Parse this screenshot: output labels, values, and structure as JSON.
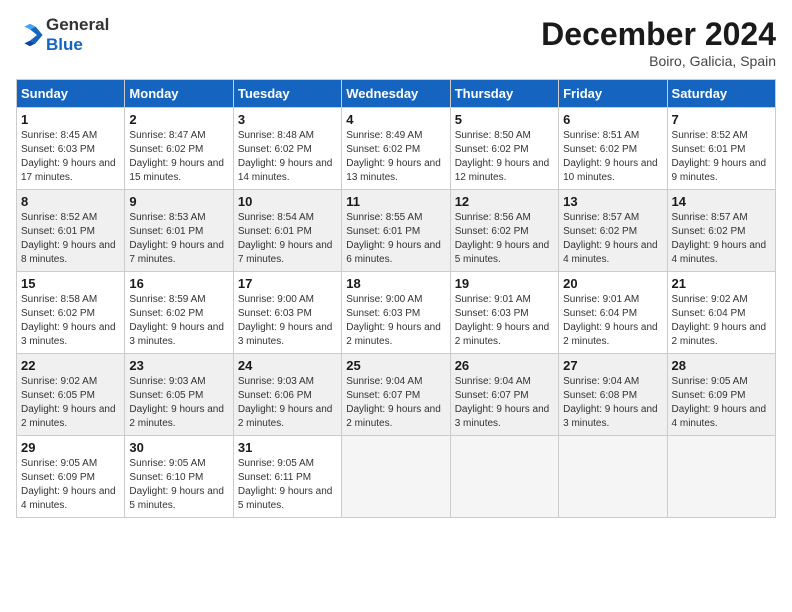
{
  "logo": {
    "general": "General",
    "blue": "Blue"
  },
  "title": "December 2024",
  "location": "Boiro, Galicia, Spain",
  "weekdays": [
    "Sunday",
    "Monday",
    "Tuesday",
    "Wednesday",
    "Thursday",
    "Friday",
    "Saturday"
  ],
  "weeks": [
    [
      {
        "day": "1",
        "sunrise": "8:45 AM",
        "sunset": "6:03 PM",
        "daylight": "9 hours and 17 minutes."
      },
      {
        "day": "2",
        "sunrise": "8:47 AM",
        "sunset": "6:02 PM",
        "daylight": "9 hours and 15 minutes."
      },
      {
        "day": "3",
        "sunrise": "8:48 AM",
        "sunset": "6:02 PM",
        "daylight": "9 hours and 14 minutes."
      },
      {
        "day": "4",
        "sunrise": "8:49 AM",
        "sunset": "6:02 PM",
        "daylight": "9 hours and 13 minutes."
      },
      {
        "day": "5",
        "sunrise": "8:50 AM",
        "sunset": "6:02 PM",
        "daylight": "9 hours and 12 minutes."
      },
      {
        "day": "6",
        "sunrise": "8:51 AM",
        "sunset": "6:02 PM",
        "daylight": "9 hours and 10 minutes."
      },
      {
        "day": "7",
        "sunrise": "8:52 AM",
        "sunset": "6:01 PM",
        "daylight": "9 hours and 9 minutes."
      }
    ],
    [
      {
        "day": "8",
        "sunrise": "8:52 AM",
        "sunset": "6:01 PM",
        "daylight": "9 hours and 8 minutes."
      },
      {
        "day": "9",
        "sunrise": "8:53 AM",
        "sunset": "6:01 PM",
        "daylight": "9 hours and 7 minutes."
      },
      {
        "day": "10",
        "sunrise": "8:54 AM",
        "sunset": "6:01 PM",
        "daylight": "9 hours and 7 minutes."
      },
      {
        "day": "11",
        "sunrise": "8:55 AM",
        "sunset": "6:01 PM",
        "daylight": "9 hours and 6 minutes."
      },
      {
        "day": "12",
        "sunrise": "8:56 AM",
        "sunset": "6:02 PM",
        "daylight": "9 hours and 5 minutes."
      },
      {
        "day": "13",
        "sunrise": "8:57 AM",
        "sunset": "6:02 PM",
        "daylight": "9 hours and 4 minutes."
      },
      {
        "day": "14",
        "sunrise": "8:57 AM",
        "sunset": "6:02 PM",
        "daylight": "9 hours and 4 minutes."
      }
    ],
    [
      {
        "day": "15",
        "sunrise": "8:58 AM",
        "sunset": "6:02 PM",
        "daylight": "9 hours and 3 minutes."
      },
      {
        "day": "16",
        "sunrise": "8:59 AM",
        "sunset": "6:02 PM",
        "daylight": "9 hours and 3 minutes."
      },
      {
        "day": "17",
        "sunrise": "9:00 AM",
        "sunset": "6:03 PM",
        "daylight": "9 hours and 3 minutes."
      },
      {
        "day": "18",
        "sunrise": "9:00 AM",
        "sunset": "6:03 PM",
        "daylight": "9 hours and 2 minutes."
      },
      {
        "day": "19",
        "sunrise": "9:01 AM",
        "sunset": "6:03 PM",
        "daylight": "9 hours and 2 minutes."
      },
      {
        "day": "20",
        "sunrise": "9:01 AM",
        "sunset": "6:04 PM",
        "daylight": "9 hours and 2 minutes."
      },
      {
        "day": "21",
        "sunrise": "9:02 AM",
        "sunset": "6:04 PM",
        "daylight": "9 hours and 2 minutes."
      }
    ],
    [
      {
        "day": "22",
        "sunrise": "9:02 AM",
        "sunset": "6:05 PM",
        "daylight": "9 hours and 2 minutes."
      },
      {
        "day": "23",
        "sunrise": "9:03 AM",
        "sunset": "6:05 PM",
        "daylight": "9 hours and 2 minutes."
      },
      {
        "day": "24",
        "sunrise": "9:03 AM",
        "sunset": "6:06 PM",
        "daylight": "9 hours and 2 minutes."
      },
      {
        "day": "25",
        "sunrise": "9:04 AM",
        "sunset": "6:07 PM",
        "daylight": "9 hours and 2 minutes."
      },
      {
        "day": "26",
        "sunrise": "9:04 AM",
        "sunset": "6:07 PM",
        "daylight": "9 hours and 3 minutes."
      },
      {
        "day": "27",
        "sunrise": "9:04 AM",
        "sunset": "6:08 PM",
        "daylight": "9 hours and 3 minutes."
      },
      {
        "day": "28",
        "sunrise": "9:05 AM",
        "sunset": "6:09 PM",
        "daylight": "9 hours and 4 minutes."
      }
    ],
    [
      {
        "day": "29",
        "sunrise": "9:05 AM",
        "sunset": "6:09 PM",
        "daylight": "9 hours and 4 minutes."
      },
      {
        "day": "30",
        "sunrise": "9:05 AM",
        "sunset": "6:10 PM",
        "daylight": "9 hours and 5 minutes."
      },
      {
        "day": "31",
        "sunrise": "9:05 AM",
        "sunset": "6:11 PM",
        "daylight": "9 hours and 5 minutes."
      },
      null,
      null,
      null,
      null
    ]
  ]
}
